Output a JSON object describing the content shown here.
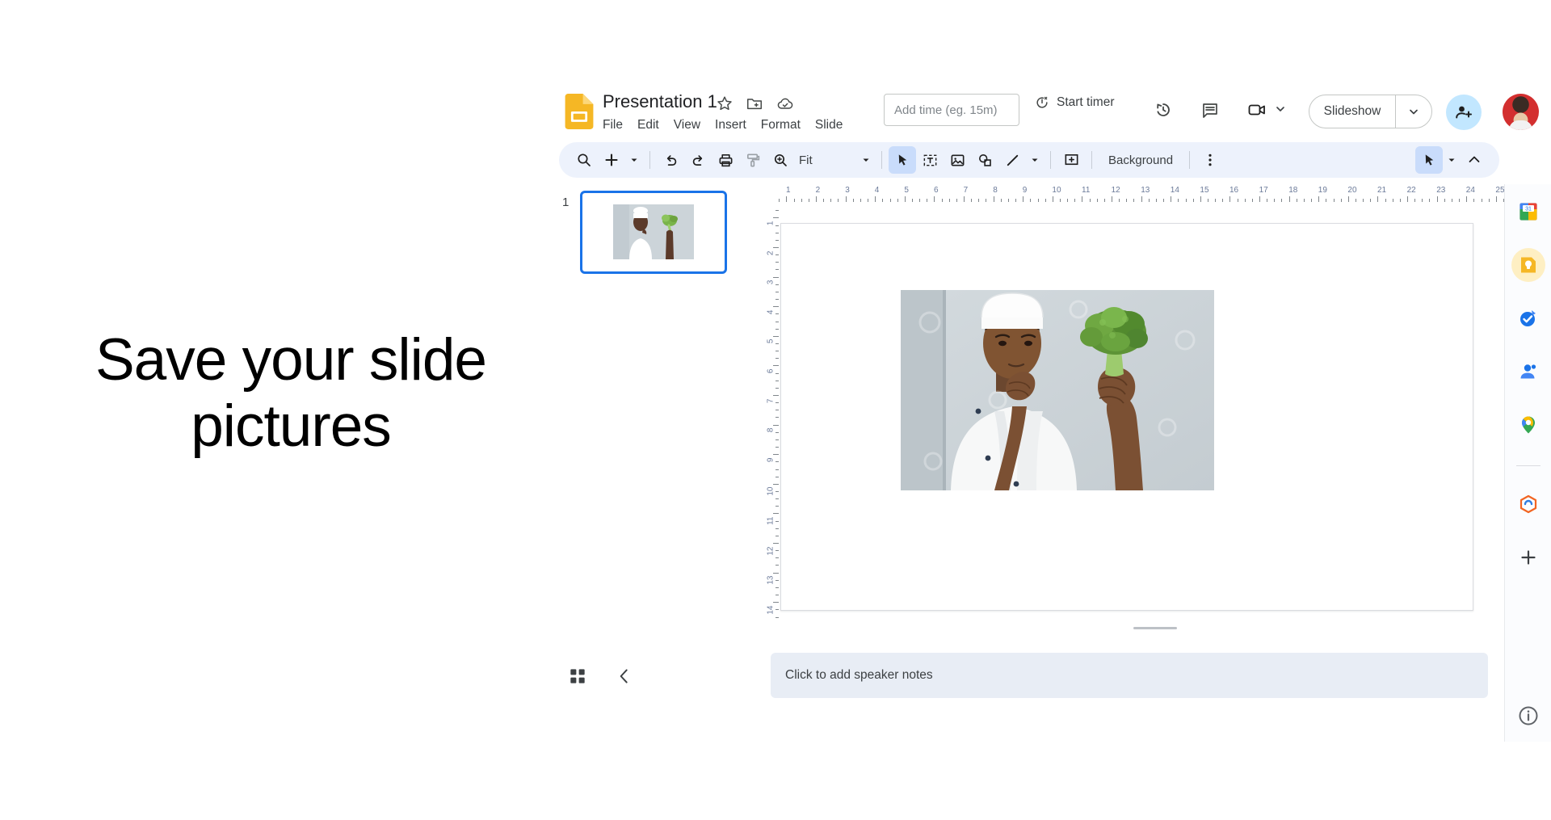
{
  "caption": {
    "text": "Save your slide pictures"
  },
  "app": {
    "doc_title": "Presentation 1",
    "logo": "google-slides-logo",
    "title_icons": [
      {
        "name": "star-icon",
        "label": "Star"
      },
      {
        "name": "move-to-folder-icon",
        "label": "Move"
      },
      {
        "name": "cloud-saved-icon",
        "label": "Saved to Drive"
      }
    ],
    "menus": [
      "File",
      "Edit",
      "View",
      "Insert",
      "Format",
      "Slide"
    ],
    "timer": {
      "placeholder": "Add time (eg. 15m)",
      "value": "",
      "start_label": "Start timer"
    },
    "header_buttons": [
      {
        "name": "version-history-icon",
        "label": "Version history"
      },
      {
        "name": "comment-icon",
        "label": "Comments"
      },
      {
        "name": "meet-camera-icon",
        "label": "Join a call"
      }
    ],
    "slideshow": {
      "label": "Slideshow",
      "dropdown": "chevron-down-icon"
    },
    "share": {
      "name": "add-person-icon",
      "label": "Share"
    },
    "avatar": {
      "name": "user-avatar",
      "label": "Account"
    }
  },
  "toolbar": {
    "search_label": "Search",
    "new_slide_label": "New slide",
    "undo_label": "Undo",
    "redo_label": "Redo",
    "print_label": "Print",
    "paint_format_label": "Paint format",
    "zoom_label": "Zoom",
    "zoom_value": "Fit",
    "select_label": "Select",
    "textbox_label": "Text box",
    "image_label": "Insert image",
    "shape_label": "Shape",
    "line_label": "Line",
    "comment_label": "Add comment",
    "background_label": "Background",
    "more_label": "More options",
    "pointer_label": "Laser pointer",
    "collapse_label": "Hide the menus"
  },
  "filmstrip": {
    "slide_number": "1",
    "grid_view_label": "Grid view",
    "collapse_label": "Collapse filmstrip"
  },
  "ruler": {
    "horizontal": [
      "1",
      "2",
      "3",
      "4",
      "5",
      "6",
      "7",
      "8",
      "9",
      "10",
      "11",
      "12",
      "13",
      "14",
      "15",
      "16",
      "17",
      "18",
      "19",
      "20",
      "21",
      "22",
      "23",
      "24",
      "25"
    ],
    "vertical": [
      "1",
      "2",
      "3",
      "4",
      "5",
      "6",
      "7",
      "8",
      "9",
      "10",
      "11",
      "12",
      "13",
      "14"
    ]
  },
  "slide": {
    "image_alt": "Chef in white uniform and hat holding broccoli",
    "image_name": "slide-image-chef-broccoli"
  },
  "notes": {
    "placeholder": "Click to add speaker notes"
  },
  "side_panel": {
    "items": [
      {
        "name": "google-calendar-icon",
        "label": "Calendar",
        "badge": "31"
      },
      {
        "name": "google-keep-icon",
        "label": "Keep"
      },
      {
        "name": "google-tasks-icon",
        "label": "Tasks"
      },
      {
        "name": "google-contacts-icon",
        "label": "Contacts"
      },
      {
        "name": "google-maps-icon",
        "label": "Maps"
      },
      {
        "name": "addon-app-icon",
        "label": "Add-on"
      },
      {
        "name": "add-addon-icon",
        "label": "Get add-ons"
      }
    ],
    "info_label": "Show side panel info"
  },
  "colors": {
    "accent_blue": "#1a73e8",
    "toolbar_bg": "#edf2fc",
    "selected_tool": "#c9dcfb",
    "share_bg": "#c2e7ff",
    "notes_bg": "#e8edf5",
    "slides_yellow": "#f5b725"
  }
}
